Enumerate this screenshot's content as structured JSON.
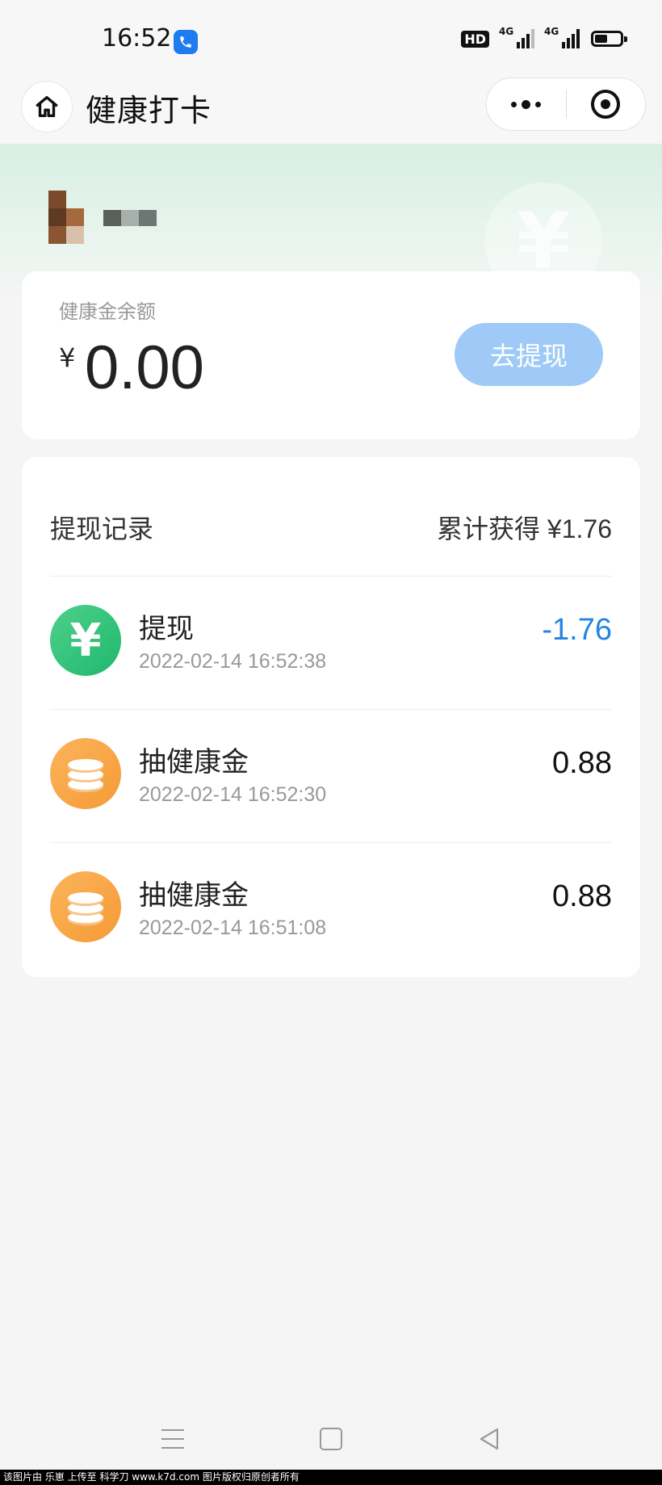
{
  "status_bar": {
    "time": "16:52",
    "hd_label": "HD",
    "signal_labels": [
      "4G",
      "4G"
    ]
  },
  "nav": {
    "title": "健康打卡"
  },
  "header": {
    "watermark_symbol": "¥"
  },
  "balance": {
    "label": "健康金余额",
    "currency": "¥",
    "value": "0.00",
    "withdraw_button": "去提现"
  },
  "records": {
    "title": "提现记录",
    "total": "累计获得 ¥1.76",
    "items": [
      {
        "title": "提现",
        "time": "2022-02-14 16:52:38",
        "amount": "-1.76",
        "icon": "yen-icon",
        "type": "withdraw"
      },
      {
        "title": "抽健康金",
        "time": "2022-02-14 16:52:30",
        "amount": "0.88",
        "icon": "coins-icon",
        "type": "earn"
      },
      {
        "title": "抽健康金",
        "time": "2022-02-14 16:51:08",
        "amount": "0.88",
        "icon": "coins-icon",
        "type": "earn"
      }
    ],
    "yen_symbol": "¥"
  },
  "footer": {
    "credit": "该图片由 乐崽 上传至 科学刀 www.k7d.com 图片版权归原创者所有"
  },
  "colors": {
    "accent_blue": "#2385e0",
    "withdraw_button": "#9fcaf7",
    "green_icon": "#1fb86e",
    "orange_icon": "#f59a36"
  }
}
